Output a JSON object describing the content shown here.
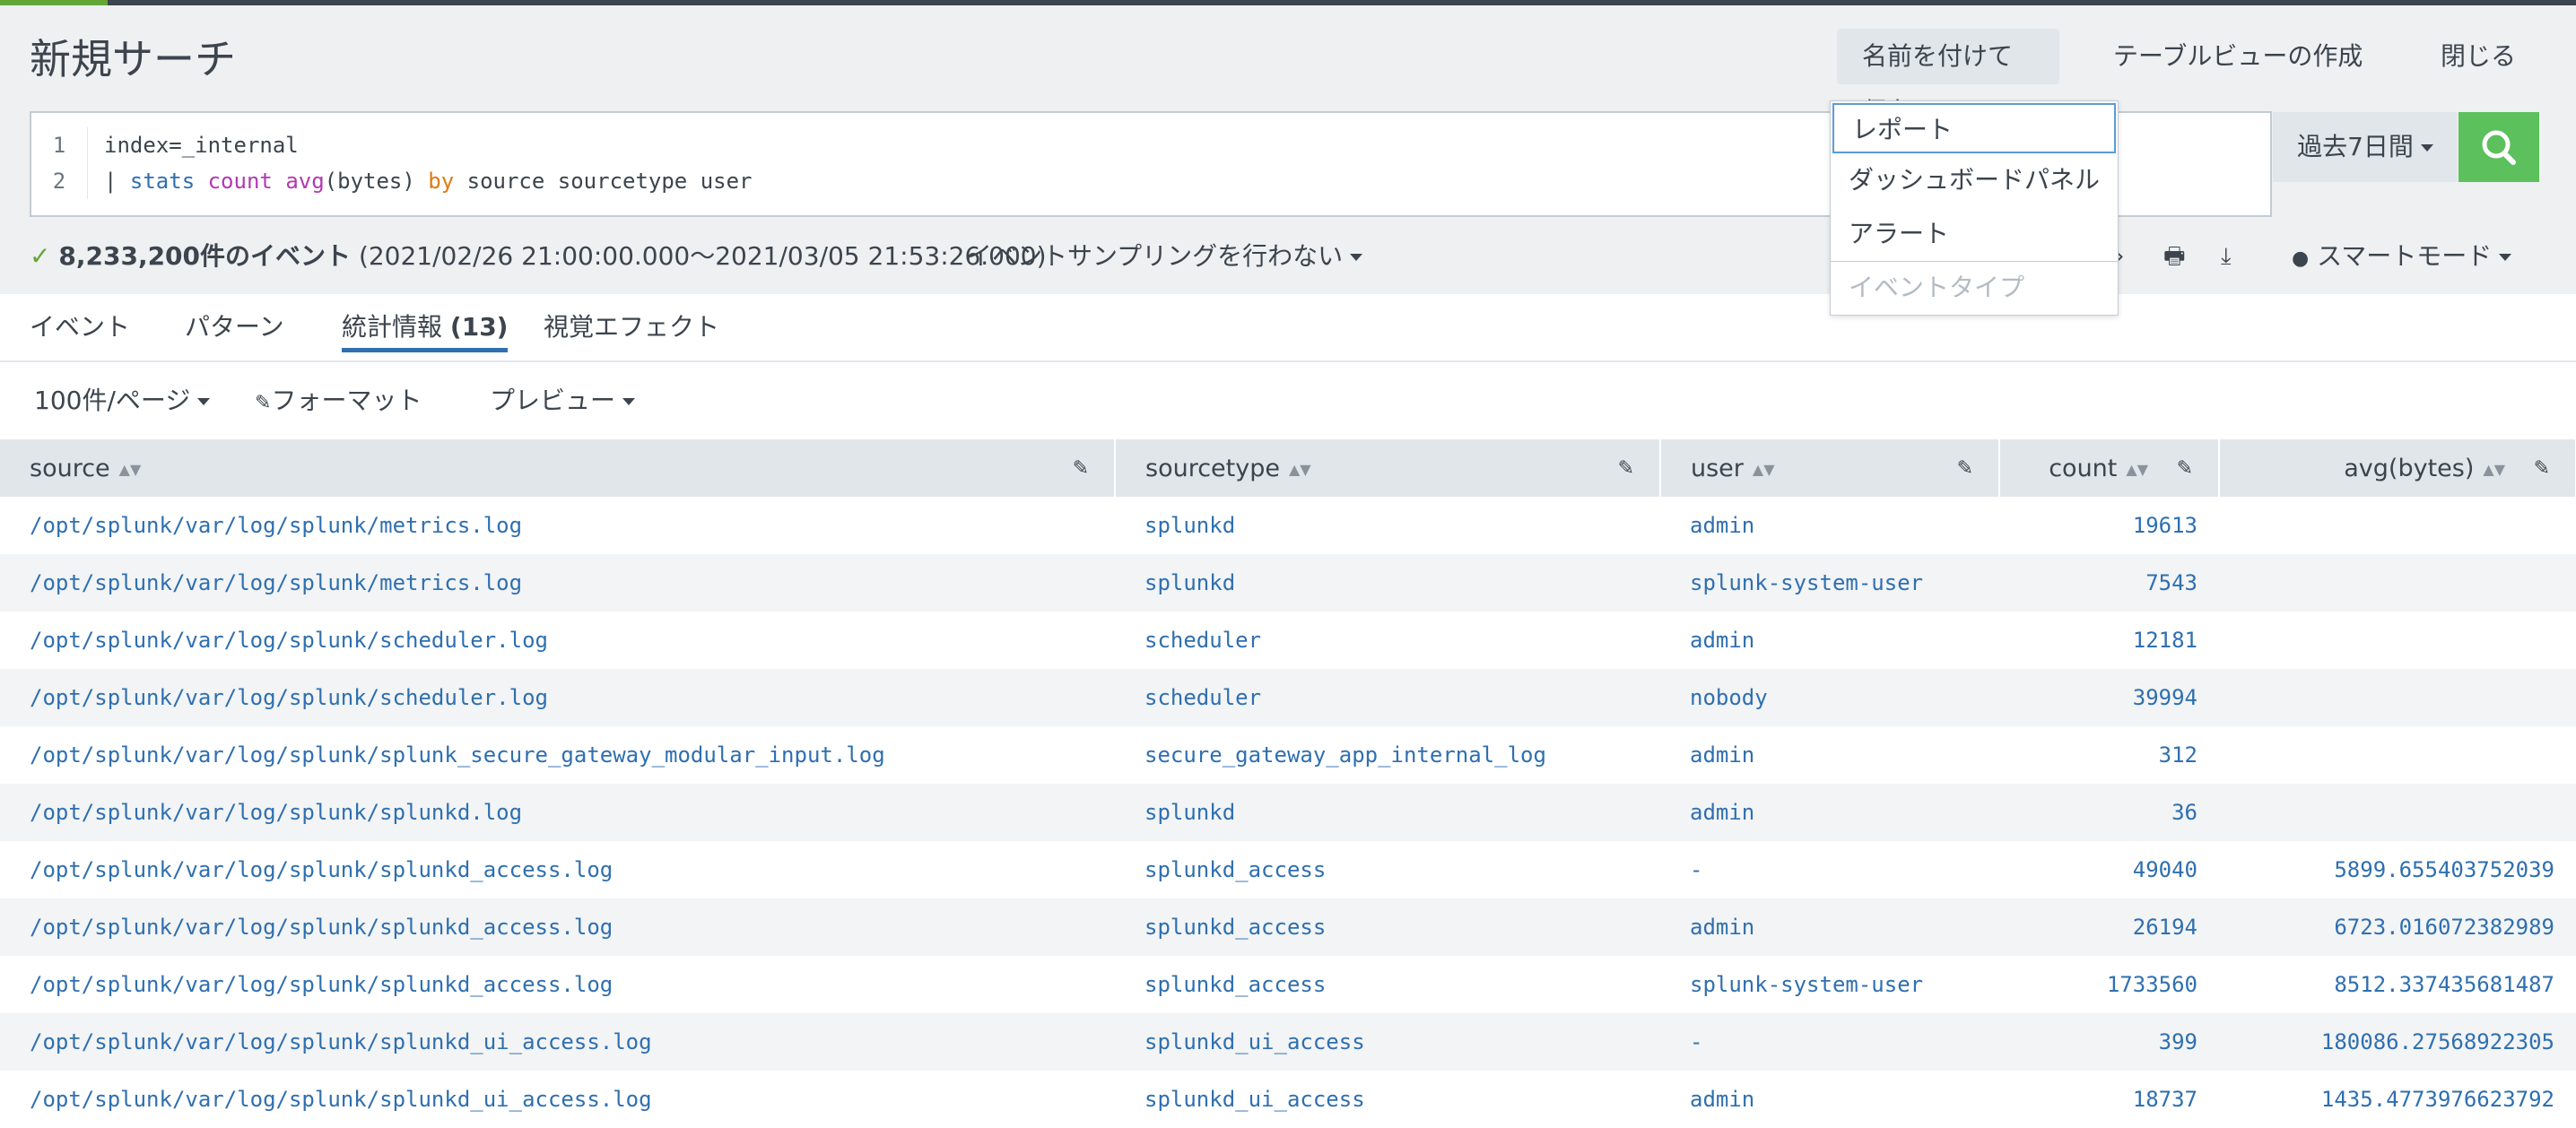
{
  "header": {
    "title": "新規サーチ",
    "save_as": "名前を付けて保存",
    "create_table": "テーブルビューの作成",
    "close": "閉じる"
  },
  "search": {
    "line1_num": "1",
    "line1": "index=_internal",
    "line2_num": "2",
    "line2_pipe": "| ",
    "line2_cmd": "stats",
    "line2_fn1": "count",
    "line2_fn2": "avg",
    "line2_args": "(bytes) ",
    "line2_by": "by",
    "line2_rest": " source sourcetype user"
  },
  "time_range": "過去7日間",
  "status": {
    "count": "8,233,200件のイベント",
    "range": "(2021/02/26 21:00:00.000〜2021/03/05 21:53:26.000)",
    "sampling": "イベントサンプリングを行わない",
    "smart_mode": "スマートモード"
  },
  "tabs": [
    {
      "label": "イベント"
    },
    {
      "label": "パターン"
    },
    {
      "label": "統計情報",
      "count": "(13)"
    },
    {
      "label": "視覚エフェクト"
    }
  ],
  "subtools": {
    "per_page": "100件/ページ",
    "format": "フォーマット",
    "preview": "プレビュー"
  },
  "dropdown": {
    "items": [
      "レポート",
      "ダッシュボードパネル",
      "アラート",
      "イベントタイプ"
    ]
  },
  "table": {
    "columns": [
      "source",
      "sourcetype",
      "user",
      "count",
      "avg(bytes)"
    ],
    "rows": [
      [
        "/opt/splunk/var/log/splunk/metrics.log",
        "splunkd",
        "admin",
        "19613",
        ""
      ],
      [
        "/opt/splunk/var/log/splunk/metrics.log",
        "splunkd",
        "splunk-system-user",
        "7543",
        ""
      ],
      [
        "/opt/splunk/var/log/splunk/scheduler.log",
        "scheduler",
        "admin",
        "12181",
        ""
      ],
      [
        "/opt/splunk/var/log/splunk/scheduler.log",
        "scheduler",
        "nobody",
        "39994",
        ""
      ],
      [
        "/opt/splunk/var/log/splunk/splunk_secure_gateway_modular_input.log",
        "secure_gateway_app_internal_log",
        "admin",
        "312",
        ""
      ],
      [
        "/opt/splunk/var/log/splunk/splunkd.log",
        "splunkd",
        "admin",
        "36",
        ""
      ],
      [
        "/opt/splunk/var/log/splunk/splunkd_access.log",
        "splunkd_access",
        "-",
        "49040",
        "5899.655403752039"
      ],
      [
        "/opt/splunk/var/log/splunk/splunkd_access.log",
        "splunkd_access",
        "admin",
        "26194",
        "6723.016072382989"
      ],
      [
        "/opt/splunk/var/log/splunk/splunkd_access.log",
        "splunkd_access",
        "splunk-system-user",
        "1733560",
        "8512.337435681487"
      ],
      [
        "/opt/splunk/var/log/splunk/splunkd_ui_access.log",
        "splunkd_ui_access",
        "-",
        "399",
        "180086.27568922305"
      ],
      [
        "/opt/splunk/var/log/splunk/splunkd_ui_access.log",
        "splunkd_ui_access",
        "admin",
        "18737",
        "1435.4773976623792"
      ]
    ]
  }
}
